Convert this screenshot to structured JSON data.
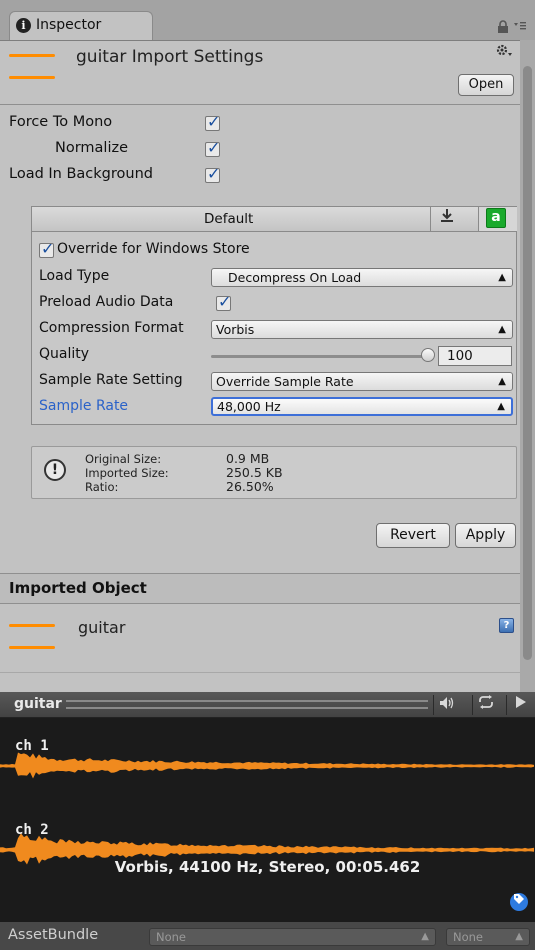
{
  "tab": {
    "title": "Inspector",
    "info_icon": "i"
  },
  "header": {
    "title": "guitar Import Settings",
    "open_label": "Open"
  },
  "toggles": [
    {
      "label": "Force To Mono",
      "checked": true
    },
    {
      "label": "Normalize",
      "checked": true
    },
    {
      "label": "Load In Background",
      "checked": true
    }
  ],
  "platform": {
    "tab_default": "Default",
    "store_icon": "a",
    "override_label": "Override for Windows Store",
    "fields": {
      "load_type": {
        "label": "Load Type",
        "value": "Decompress On Load"
      },
      "preload": {
        "label": "Preload Audio Data"
      },
      "compression": {
        "label": "Compression Format",
        "value": "Vorbis"
      },
      "quality": {
        "label": "Quality",
        "value": "100",
        "slider_fraction": 1.0
      },
      "sample_rate_setting": {
        "label": "Sample Rate Setting",
        "value": "Override Sample Rate"
      },
      "sample_rate": {
        "label": "Sample Rate",
        "value": "48,000 Hz"
      }
    }
  },
  "info": {
    "original_label": "Original Size:",
    "original_value": "0.9 MB",
    "imported_label": "Imported Size:",
    "imported_value": "250.5 KB",
    "ratio_label": "Ratio:",
    "ratio_value": "26.50%"
  },
  "actions": {
    "revert": "Revert",
    "apply": "Apply"
  },
  "imported_object": {
    "heading": "Imported Object",
    "name": "guitar",
    "help_icon": "?"
  },
  "preview": {
    "title": "guitar",
    "channels": [
      "ch 1",
      "ch 2"
    ],
    "info": "Vorbis, 44100 Hz, Stereo, 00:05.462",
    "wave_color": "#f08a1e"
  },
  "assetbundle": {
    "label": "AssetBundle",
    "bundle": "None",
    "variant": "None"
  },
  "colors": {
    "accent_orange": "#ff8c00",
    "focus_blue": "#3d6fd8",
    "label_blue": "#2a62c9"
  }
}
